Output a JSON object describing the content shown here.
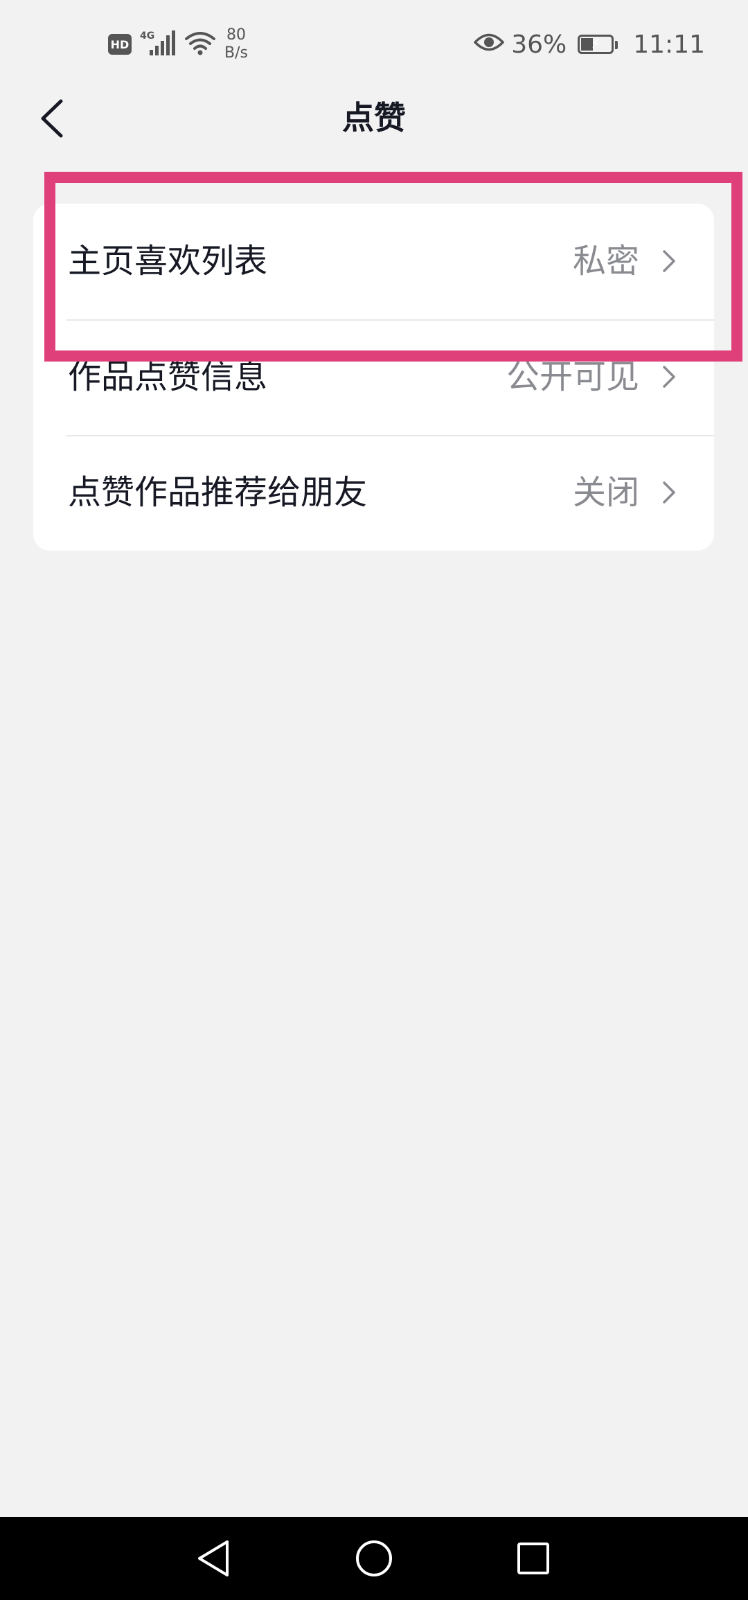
{
  "status_bar": {
    "hd_badge": "HD",
    "network_type": "4G",
    "net_speed_value": "80",
    "net_speed_unit": "B/s",
    "battery_percent": "36%",
    "battery_level": 0.36,
    "time": "11:11"
  },
  "header": {
    "title": "点赞",
    "back_icon": "chevron-left-icon"
  },
  "settings": {
    "items": [
      {
        "label": "主页喜欢列表",
        "value": "私密"
      },
      {
        "label": "作品点赞信息",
        "value": "公开可见"
      },
      {
        "label": "点赞作品推荐给朋友",
        "value": "关闭"
      }
    ]
  },
  "colors": {
    "background": "#f2f2f3",
    "card": "#ffffff",
    "highlight": "#e0407a",
    "title_text": "#161823",
    "value_text": "#8a8b91"
  },
  "nav_bar": {
    "back_icon": "triangle-back-icon",
    "home_icon": "circle-home-icon",
    "recents_icon": "square-recents-icon"
  }
}
